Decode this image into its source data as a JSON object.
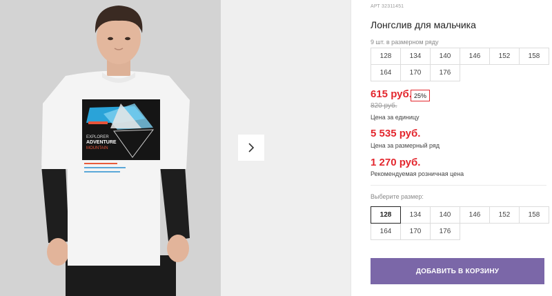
{
  "product": {
    "article": "АРТ 32311451",
    "title": "Лонгслив для мальчика",
    "size_row_note": "9 шт. в размерном ряду",
    "size_row": [
      "128",
      "134",
      "140",
      "146",
      "152",
      "158",
      "164",
      "170",
      "176"
    ]
  },
  "pricing": {
    "unit_price": "615 руб.",
    "discount": "25%",
    "old_price": "820 руб.",
    "unit_label": "Цена за единицу",
    "row_price": "5 535 руб.",
    "row_label": "Цена за размерный ряд",
    "retail_price": "1 270 руб.",
    "retail_label": "Рекомендуемая розничная цена"
  },
  "size_select": {
    "label": "Выберите размер:",
    "selected": "128",
    "options": [
      "128",
      "134",
      "140",
      "146",
      "152",
      "158",
      "164",
      "170",
      "176"
    ]
  },
  "actions": {
    "add_to_cart": "ДОБАВИТЬ В КОРЗИНУ"
  },
  "print_text": {
    "line1": "EXPLORER",
    "line2": "ADVENTURE",
    "line3": "MOUNTAIN"
  },
  "colors": {
    "accent_purple": "#7b67a8",
    "price_red": "#e3262d"
  },
  "icons": {
    "next": "chevron-right-icon"
  }
}
